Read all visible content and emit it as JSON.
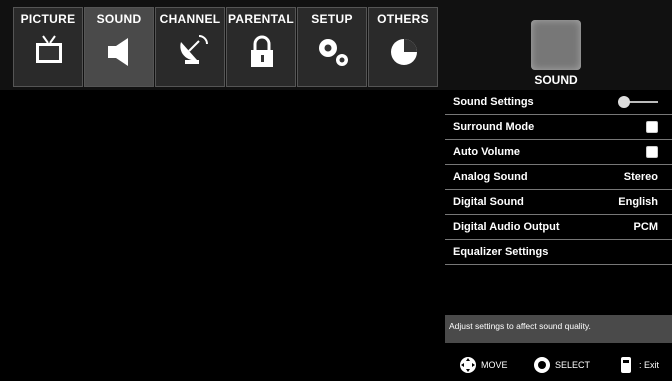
{
  "tabs": [
    {
      "id": "picture",
      "label": "PICTURE",
      "icon": "tv-icon",
      "active": false
    },
    {
      "id": "sound",
      "label": "SOUND",
      "icon": "speaker-icon",
      "active": true
    },
    {
      "id": "channel",
      "label": "CHANNEL",
      "icon": "satellite-dish-icon",
      "active": false
    },
    {
      "id": "parental",
      "label": "PARENTAL",
      "icon": "lock-icon",
      "active": false
    },
    {
      "id": "setup",
      "label": "SETUP",
      "icon": "gears-icon",
      "active": false
    },
    {
      "id": "others",
      "label": "OTHERS",
      "icon": "pie-chart-icon",
      "active": false
    }
  ],
  "section": {
    "label": "SOUND",
    "icon": "sound-panel-icon"
  },
  "menu": {
    "items": [
      {
        "label": "Sound Settings",
        "control": "slider"
      },
      {
        "label": "Surround Mode",
        "control": "checkbox",
        "checked": true
      },
      {
        "label": "Auto Volume",
        "control": "checkbox",
        "checked": true
      },
      {
        "label": "Analog Sound",
        "value": "Stereo"
      },
      {
        "label": "Digital Sound",
        "value": "English"
      },
      {
        "label": "Digital Audio Output",
        "value": "PCM"
      },
      {
        "label": "Equalizer Settings",
        "value": ""
      }
    ]
  },
  "help": {
    "text": "Adjust settings to affect sound quality."
  },
  "footer": {
    "move": "MOVE",
    "select": "SELECT",
    "exit": ": Exit"
  }
}
